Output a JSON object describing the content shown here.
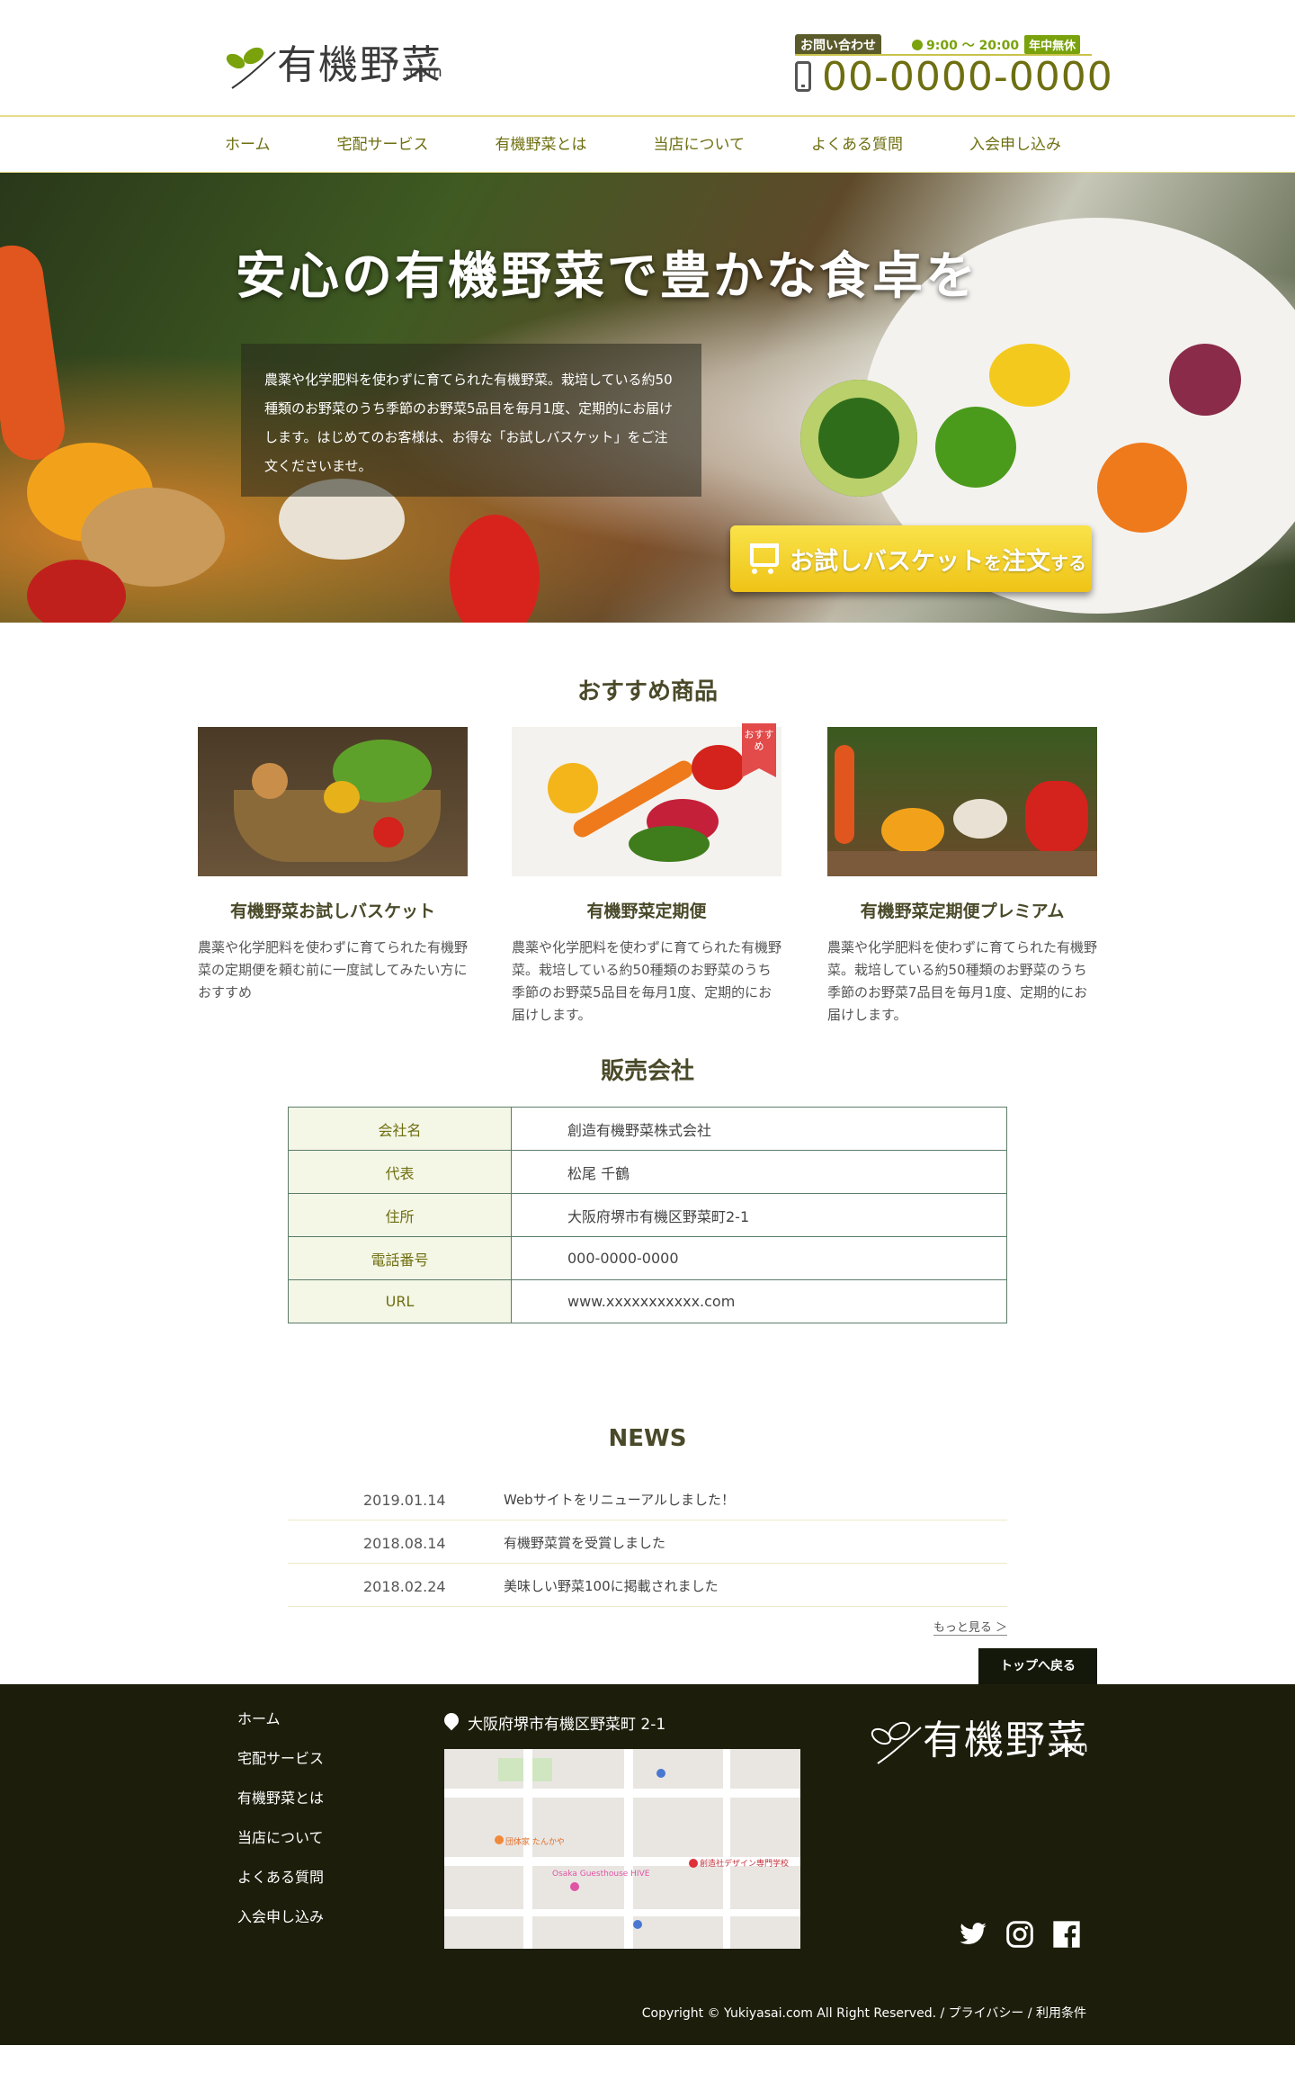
{
  "header": {
    "logo_text": "有機野菜",
    "logo_suffix": ".com",
    "contact_label": "お問い合わせ",
    "hours": "9:00 〜 20:00",
    "open_badge": "年中無休",
    "phone": "00-0000-0000"
  },
  "nav": {
    "items": [
      "ホーム",
      "宅配サービス",
      "有機野菜とは",
      "当店について",
      "よくある質問",
      "入会申し込み"
    ]
  },
  "hero": {
    "title": "安心の有機野菜で豊かな食卓を",
    "description": "農薬や化学肥料を使わずに育てられた有機野菜。栽培している約50種類のお野菜のうち季節のお野菜5品目を毎月1度、定期的にお届けします。はじめてのお客様は、お得な「お試しバスケット」をご注文くださいませ。",
    "cta_main": "お試しバスケット",
    "cta_sub1": "を",
    "cta_main2": "注文",
    "cta_sub2": "する"
  },
  "products": {
    "title": "おすすめ商品",
    "ribbon": "おすすめ",
    "items": [
      {
        "name": "有機野菜お試しバスケット",
        "desc": "農薬や化学肥料を使わずに育てられた有機野菜の定期便を頼む前に一度試してみたい方におすすめ"
      },
      {
        "name": "有機野菜定期便",
        "desc": "農薬や化学肥料を使わずに育てられた有機野菜。栽培している約50種類のお野菜のうち季節のお野菜5品目を毎月1度、定期的にお届けします。"
      },
      {
        "name": "有機野菜定期便プレミアム",
        "desc": "農薬や化学肥料を使わずに育てられた有機野菜。栽培している約50種類のお野菜のうち季節のお野菜7品目を毎月1度、定期的にお届けします。"
      }
    ]
  },
  "company": {
    "title": "販売会社",
    "rows": [
      {
        "label": "会社名",
        "value": "創造有機野菜株式会社"
      },
      {
        "label": "代表",
        "value": "松尾 千鶴"
      },
      {
        "label": "住所",
        "value": "大阪府堺市有機区野菜町2-1"
      },
      {
        "label": "電話番号",
        "value": "000-0000-0000"
      },
      {
        "label": "URL",
        "value": "www.xxxxxxxxxxx.com"
      }
    ]
  },
  "news": {
    "title": "NEWS",
    "items": [
      {
        "date": "2019.01.14",
        "text": "Webサイトをリニューアルしました！"
      },
      {
        "date": "2018.08.14",
        "text": "有機野菜賞を受賞しました"
      },
      {
        "date": "2018.02.24",
        "text": "美味しい野菜100に掲載されました"
      }
    ],
    "more": "もっと見る ＞"
  },
  "to_top": "トップへ戻る",
  "footer": {
    "nav": [
      "ホーム",
      "宅配サービス",
      "有機野菜とは",
      "当店について",
      "よくある質問",
      "入会申し込み"
    ],
    "address": "大阪府堺市有機区野菜町 2-1",
    "map_labels": {
      "school": "創造社デザイン専門学校",
      "hostel": "Osaka Guesthouse HIVE",
      "cafe": "団体家 たんかや"
    },
    "logo_text": "有機野菜",
    "logo_suffix": ".com",
    "social": [
      "twitter-icon",
      "instagram-icon",
      "facebook-icon"
    ],
    "copyright": "Copyright © Yukiyasai.com All Right Reserved. / プライバシー / 利用条件"
  },
  "colors": {
    "accent": "#6e6f10",
    "green": "#7aa20c",
    "cta": "#f3cf24",
    "footer": "#1c1e0b"
  }
}
